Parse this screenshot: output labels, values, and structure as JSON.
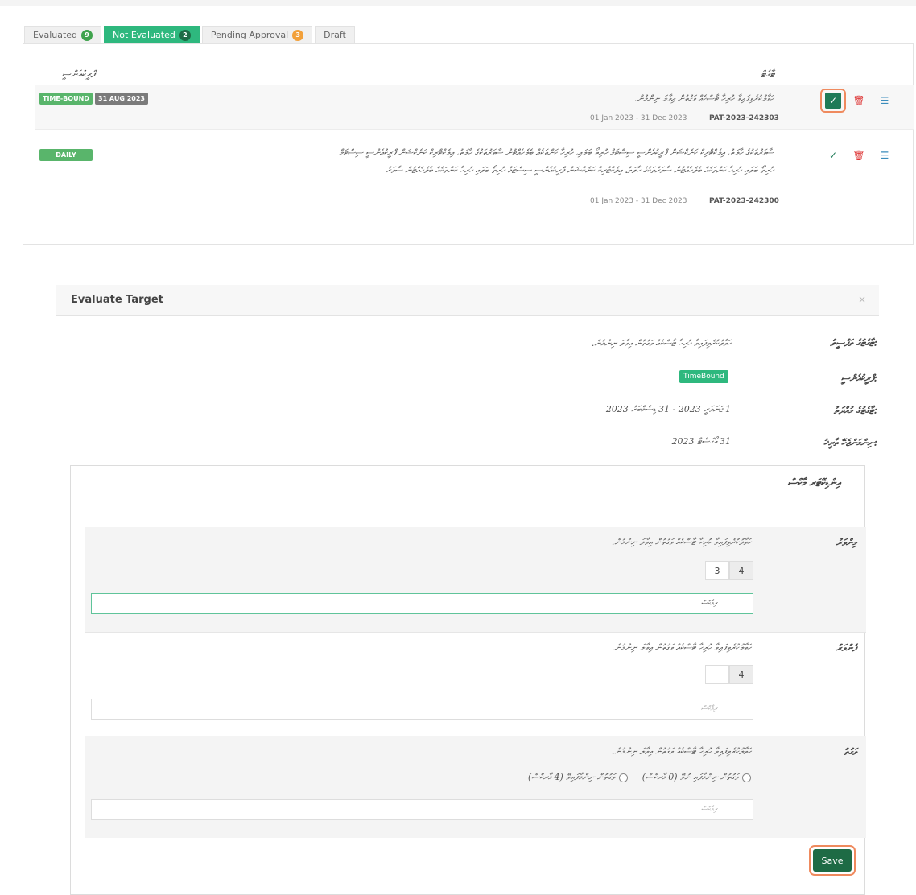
{
  "tabs": [
    {
      "label": "Evaluated",
      "count": "9"
    },
    {
      "label": "Not Evaluated",
      "count": "2"
    },
    {
      "label": "Pending Approval",
      "count": "3"
    },
    {
      "label": "Draft"
    }
  ],
  "table": {
    "header_right": "ޓާގެޓް",
    "header_left": "ފްރީކުއެންސީ",
    "rows": [
      {
        "tags": [
          "TIME-BOUND",
          "31 AUG 2023"
        ],
        "title": "ހަވާލުކުރެވިފައިވާ ހުރިހާ ޓާސްކެއް ވަގުތުން އިވާލަ ނިންމުން.",
        "dates": "01 Jan 2023 - 31 Dec 2023",
        "code": "PAT-2023-242303"
      },
      {
        "tags": [
          "DAILY"
        ],
        "title_line1": "ސާވަރުތަކުގެ ހާލަތު، އިލެކްޓްރިކް ކަނެކްޝަން ފްރީކުއެންސީ ސިސްޓަމް ހުރިތޯ ބަލައި، ހުރިހާ ކަންތަކެއް ބެލެހެއްޓުން ސާވަރުތަކުގެ ހާލަތު، އިލެކްޓްރިކް ކަނެކްޝަން ފްރީކުއެންސީ ސިސްޓަމް",
        "title_line2": "ހުރިތޯ ބަލައި ހުރިހާ ކަންތަކެއް ބެލެހެއްޓުން ސާވަރުތަކުގެ ހާލަތު، އިލެކްޓްރިކް ކަނެކްޝަން ފްރީކުއެންސީ ސިސްޓަމް ހުރިތޯ ބަލައި ހުރިހާ ކަންތަކެއް ބެލެހެއްޓުން ސާވަރު",
        "dates": "01 Jan 2023 - 31 Dec 2023",
        "code": "PAT-2023-242300"
      }
    ]
  },
  "modal": {
    "title": "Evaluate Target",
    "close": "×",
    "fields": [
      {
        "label": "ޓާގެޓުގެ ތަފްސީލު:",
        "value": "ހަވާލުކުރެވިފައިވާ ހުރިހާ ޓާސްކެއް ވަގުތުން އިވާލަ ނިންމުން."
      },
      {
        "label": "ފްރީކުއެންސީ:",
        "value": "TimeBound"
      },
      {
        "label": "ޓާގެޓުގެ މުއްދަތު:",
        "value": "1 ޖަނަވަރީ 2023 - 31 ޑިސެމްބަރު 2023"
      },
      {
        "label": "ނިންމަންޖެހޭ ތާރީޚު:",
        "value": "31 އޯގަސްޓް 2023"
      }
    ],
    "card_title": "އިންޑިކޭޓަރ މާކްސް",
    "sections": [
      {
        "label": "މިންވަރު",
        "text": "ހަވާލުކުރެވިފައިވާ ހުރިހާ ޓާސްކެއް ވަގުތުން އިވާލަ ނިންމުން.",
        "score_value": "3",
        "score_max": "4",
        "remark_placeholder": "ރިމާކްސް"
      },
      {
        "label": "ފެންވަރު",
        "text": "ހަވާލުކުރެވިފައިވާ ހުރިހާ ޓާސްކެއް ވަގުތުން އިވާލަ ނިންމުން.",
        "score_value": "",
        "score_max": "4",
        "remark_placeholder": "ރިމާކްސް"
      },
      {
        "label": "ވަގުތު",
        "text": "ހަވާލުކުރެވިފައިވާ ހުރިހާ ޓާސްކެއް ވަގުތުން އިވާލަ ނިންމުން.",
        "radio_options": [
          "ވަގުތުން ނިންމާފައި ނުވޭ (0 މާރކްސް)",
          "ވަގުތުން ނިންމާފައިވޭ (4 މާރކްސް)"
        ],
        "remark_placeholder": "ރިމާކްސް"
      }
    ],
    "save_label": "Save"
  },
  "icons": {
    "evaluate": "double-check-icon",
    "delete": "trash-icon",
    "details": "list-icon"
  },
  "colors": {
    "accent": "#2eb87e",
    "dark_green": "#1e6b45",
    "danger": "#dd3333",
    "highlight_ring": "#ef8a5e"
  }
}
